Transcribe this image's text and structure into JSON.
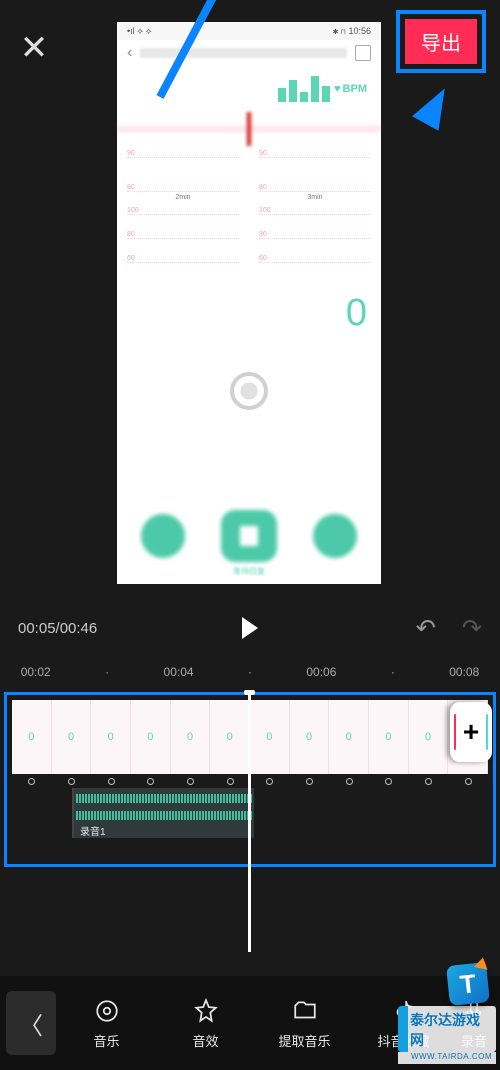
{
  "topbar": {
    "close_glyph": "✕",
    "export_label": "导出"
  },
  "preview": {
    "status": {
      "time": "10:56"
    },
    "back_glyph": "‹",
    "bpm_label": "BPM",
    "heart_glyph": "♥",
    "chart1": {
      "t1": "90",
      "t2": "80",
      "xlabel": "2min"
    },
    "chart2": {
      "t1": "90",
      "t2": "80",
      "xlabel": "3min"
    },
    "chart3": {
      "t1": "100",
      "t2": "80",
      "t3": "60"
    },
    "chart4": {
      "t1": "100",
      "t2": "80",
      "t3": "60"
    },
    "big_value": "0",
    "bottom_label": "等待回复"
  },
  "controls": {
    "timepos": "00:05/00:46",
    "undo_glyph": "↶",
    "redo_glyph": "↷"
  },
  "ruler": {
    "t1": "00:02",
    "d1": "·",
    "t2": "00:04",
    "d2": "·",
    "t3": "00:06",
    "d3": "·",
    "t4": "00:08"
  },
  "timeline": {
    "zero": "0",
    "add_glyph": "+",
    "audio_label": "录音1"
  },
  "bottombar": {
    "back_glyph": "〈",
    "items": [
      {
        "label": "音乐"
      },
      {
        "label": "音效"
      },
      {
        "label": "提取音乐"
      },
      {
        "label": "抖音收藏"
      },
      {
        "label": "录音"
      }
    ]
  },
  "watermark": {
    "badge": "T",
    "text": "泰尔达游戏网",
    "url": "WWW.TAIRDA.COM"
  }
}
